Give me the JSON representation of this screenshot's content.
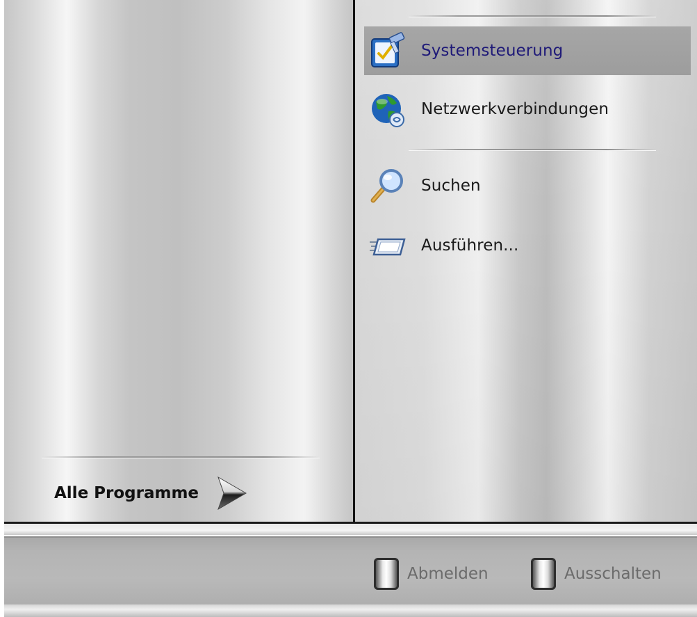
{
  "right_panel": {
    "items": [
      {
        "label": "Systemsteuerung",
        "icon": "control-panel-icon"
      },
      {
        "label": "Netzwerkverbindungen",
        "icon": "network-globe-icon"
      },
      {
        "label": "Suchen",
        "icon": "search-magnifier-icon"
      },
      {
        "label": "Ausführen...",
        "icon": "run-icon"
      }
    ]
  },
  "left_panel": {
    "all_programs_label": "Alle Programme",
    "all_programs_icon": "arrow-right-icon"
  },
  "footer": {
    "logoff_label": "Abmelden",
    "shutdown_label": "Ausschalten",
    "logoff_icon": "logoff-icon",
    "shutdown_icon": "power-icon"
  },
  "colors": {
    "highlight_text": "#1f1a78",
    "highlight_bg": "#a3a3a3",
    "divider": "#121212"
  }
}
